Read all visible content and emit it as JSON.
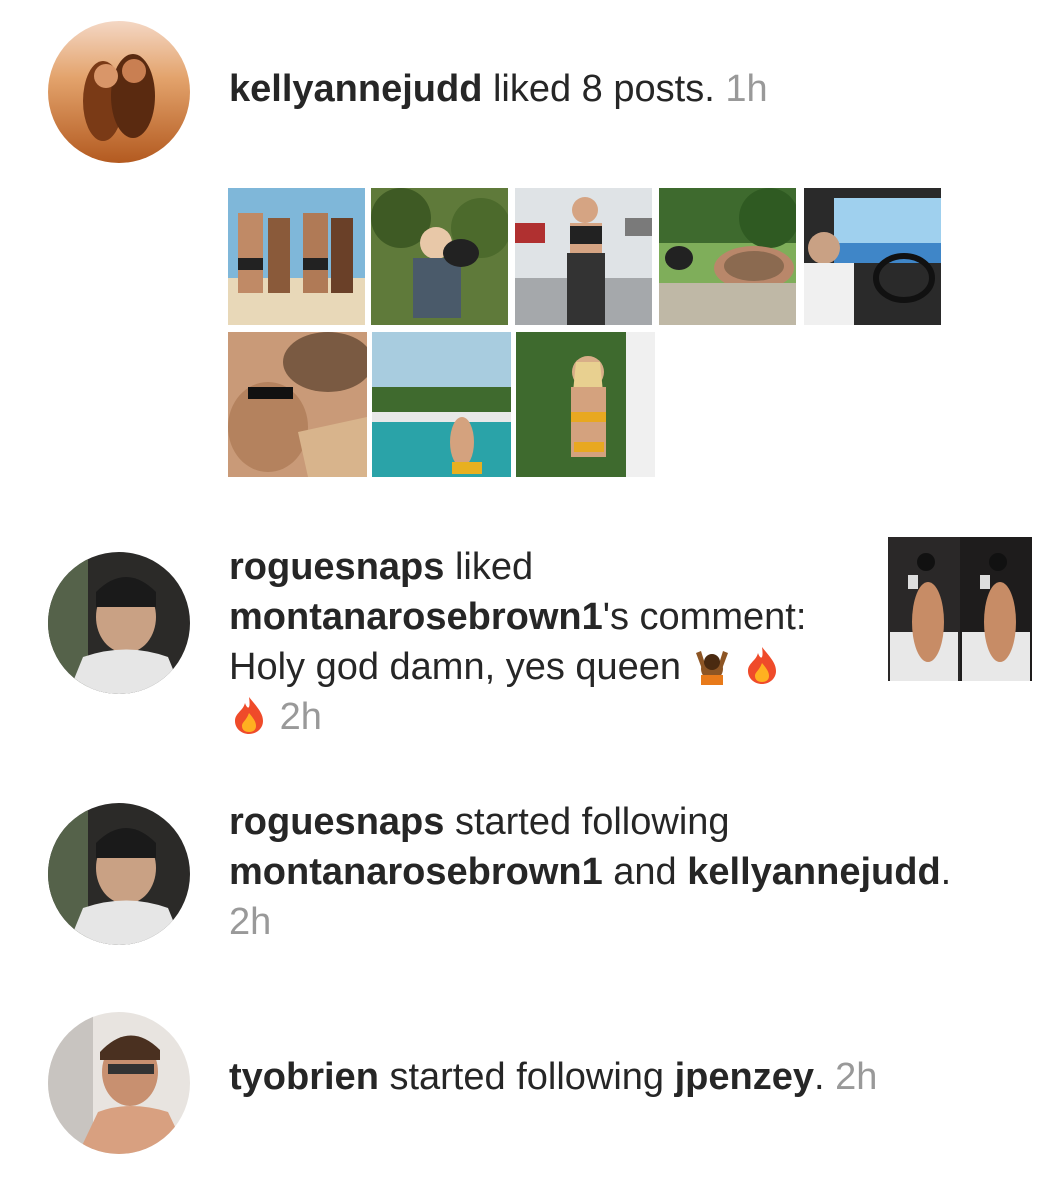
{
  "notifications": [
    {
      "user": "kellyannejudd",
      "action": " liked 8 posts. ",
      "time": "1h"
    },
    {
      "user": "roguesnaps",
      "action": " liked",
      "target": "montanarosebrown1",
      "suffix": "'s comment:",
      "comment": "Holy god damn, yes queen",
      "time": "2h"
    },
    {
      "user": "roguesnaps",
      "action": " started following",
      "target1": "montanarosebrown1",
      "joiner": " and ",
      "target2": "kellyannejudd",
      "end": ".",
      "time": "2h"
    },
    {
      "user": "tyobrien",
      "action": " started following ",
      "target": "jpenzey",
      "end": ". ",
      "time": "2h"
    }
  ],
  "icons": {
    "emoji_1": "person-raising-hands-emoji",
    "emoji_2": "fire-emoji"
  },
  "colors": {
    "text": "#262626",
    "timestamp": "#999999"
  }
}
